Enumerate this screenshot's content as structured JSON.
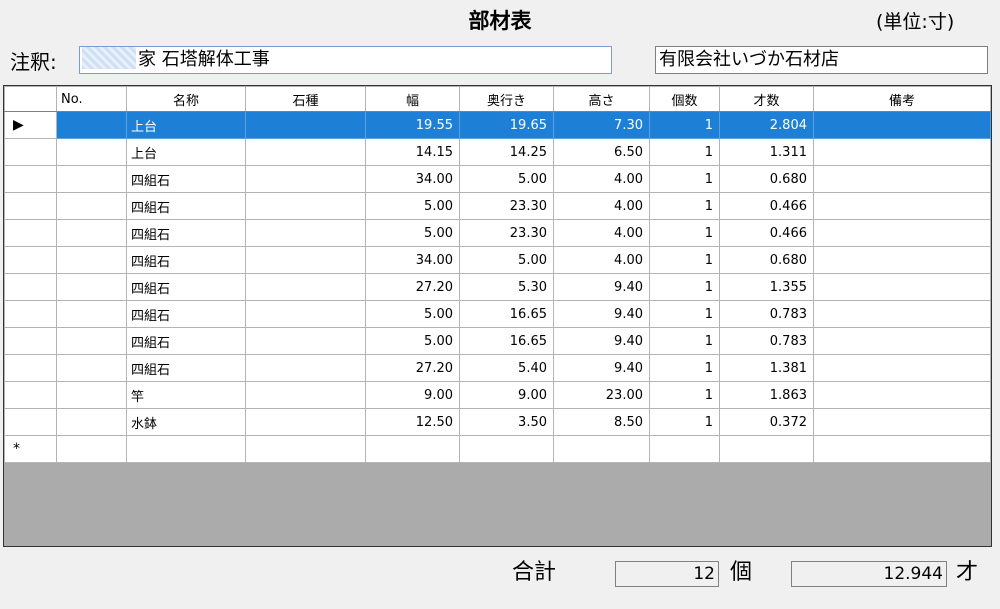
{
  "header": {
    "title": "部材表",
    "unit": "(単位:寸)"
  },
  "order": {
    "label": "注釈:",
    "value": "家  石塔解体工事"
  },
  "vendor": {
    "value": "有限会社いづか石材店"
  },
  "grid": {
    "columns": [
      "No.",
      "名称",
      "石種",
      "幅",
      "奥行き",
      "高さ",
      "個数",
      "才数",
      "備考"
    ],
    "selected_marker": "▶",
    "new_row_marker": "*",
    "rows": [
      {
        "no": "",
        "name": "上台",
        "stone": "",
        "width": "19.55",
        "depth": "19.65",
        "height": "7.30",
        "qty": "1",
        "sai": "2.804",
        "note": ""
      },
      {
        "no": "",
        "name": "上台",
        "stone": "",
        "width": "14.15",
        "depth": "14.25",
        "height": "6.50",
        "qty": "1",
        "sai": "1.311",
        "note": ""
      },
      {
        "no": "",
        "name": "四組石",
        "stone": "",
        "width": "34.00",
        "depth": "5.00",
        "height": "4.00",
        "qty": "1",
        "sai": "0.680",
        "note": ""
      },
      {
        "no": "",
        "name": "四組石",
        "stone": "",
        "width": "5.00",
        "depth": "23.30",
        "height": "4.00",
        "qty": "1",
        "sai": "0.466",
        "note": ""
      },
      {
        "no": "",
        "name": "四組石",
        "stone": "",
        "width": "5.00",
        "depth": "23.30",
        "height": "4.00",
        "qty": "1",
        "sai": "0.466",
        "note": ""
      },
      {
        "no": "",
        "name": "四組石",
        "stone": "",
        "width": "34.00",
        "depth": "5.00",
        "height": "4.00",
        "qty": "1",
        "sai": "0.680",
        "note": ""
      },
      {
        "no": "",
        "name": "四組石",
        "stone": "",
        "width": "27.20",
        "depth": "5.30",
        "height": "9.40",
        "qty": "1",
        "sai": "1.355",
        "note": ""
      },
      {
        "no": "",
        "name": "四組石",
        "stone": "",
        "width": "5.00",
        "depth": "16.65",
        "height": "9.40",
        "qty": "1",
        "sai": "0.783",
        "note": ""
      },
      {
        "no": "",
        "name": "四組石",
        "stone": "",
        "width": "5.00",
        "depth": "16.65",
        "height": "9.40",
        "qty": "1",
        "sai": "0.783",
        "note": ""
      },
      {
        "no": "",
        "name": "四組石",
        "stone": "",
        "width": "27.20",
        "depth": "5.40",
        "height": "9.40",
        "qty": "1",
        "sai": "1.381",
        "note": ""
      },
      {
        "no": "",
        "name": "竿",
        "stone": "",
        "width": "9.00",
        "depth": "9.00",
        "height": "23.00",
        "qty": "1",
        "sai": "1.863",
        "note": ""
      },
      {
        "no": "",
        "name": "水鉢",
        "stone": "",
        "width": "12.50",
        "depth": "3.50",
        "height": "8.50",
        "qty": "1",
        "sai": "0.372",
        "note": ""
      }
    ]
  },
  "footer": {
    "total_label": "合計",
    "count_value": "12",
    "count_unit": "個",
    "sai_value": "12.944",
    "sai_unit": "才"
  },
  "colors": {
    "selection": "#1e7fd6",
    "empty_area": "#ababab"
  }
}
